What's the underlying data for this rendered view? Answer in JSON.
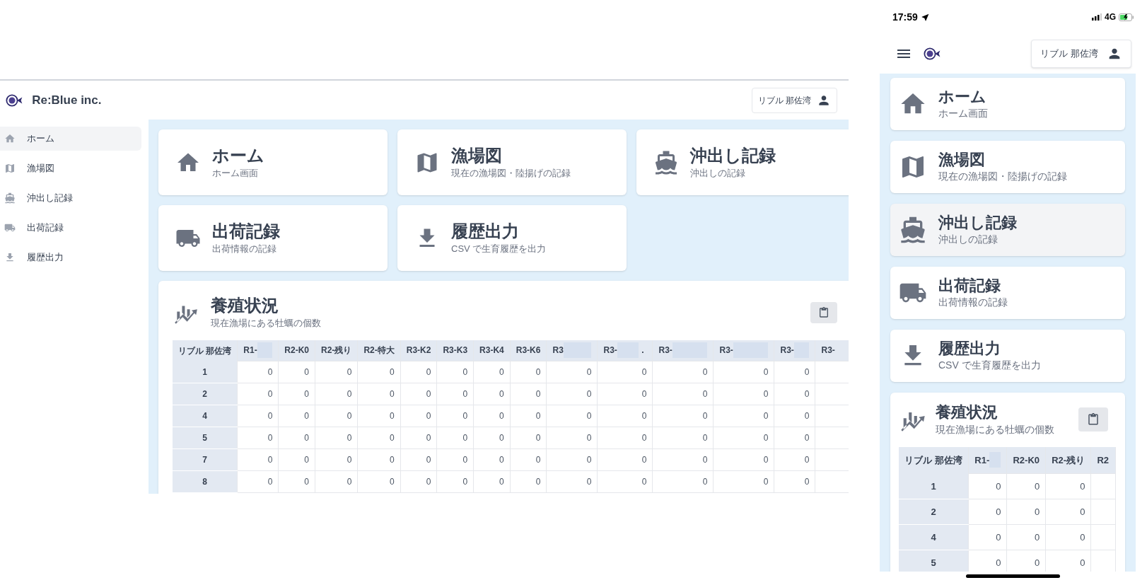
{
  "desktop": {
    "header": {
      "brand": "Re:Blue inc.",
      "user": "リブル 那佐湾"
    },
    "sidebar": {
      "items": [
        {
          "kind": "home",
          "label": "ホーム",
          "selected": true
        },
        {
          "kind": "map",
          "label": "漁場図",
          "selected": false
        },
        {
          "kind": "boat",
          "label": "沖出し記録",
          "selected": false
        },
        {
          "kind": "truck",
          "label": "出荷記録",
          "selected": false
        },
        {
          "kind": "download",
          "label": "履歴出力",
          "selected": false
        }
      ]
    },
    "cards": [
      {
        "kind": "home",
        "title": "ホーム",
        "subtitle": "ホーム画面"
      },
      {
        "kind": "map",
        "title": "漁場図",
        "subtitle": "現在の漁場図・陸揚げの記録"
      },
      {
        "kind": "boat",
        "title": "沖出し記録",
        "subtitle": "沖出しの記録"
      },
      {
        "kind": "truck",
        "title": "出荷記録",
        "subtitle": "出荷情報の記録"
      },
      {
        "kind": "download",
        "title": "履歴出力",
        "subtitle": "CSV で生育履歴を出力"
      }
    ],
    "status_panel": {
      "title": "養殖状況",
      "subtitle": "現在漁場にある牡蠣の個数",
      "table": {
        "columns": [
          {
            "label": "リブル 那佐湾"
          },
          {
            "label": "R1-",
            "redacted": true
          },
          {
            "label": "R2-K0"
          },
          {
            "label": "R2-残り"
          },
          {
            "label": "R2-特大"
          },
          {
            "label": "R3-K2"
          },
          {
            "label": "R3-K3"
          },
          {
            "label": "R3-K4"
          },
          {
            "label": "R3-K6"
          },
          {
            "label": "R3",
            "redacted": true
          },
          {
            "label": "R3-",
            "redacted": true,
            "suffix": "."
          },
          {
            "label": "R3-",
            "redacted": true
          },
          {
            "label": "R3-",
            "redacted": true
          },
          {
            "label": "R3-",
            "redacted": true
          },
          {
            "label": "R3-"
          }
        ],
        "rows": [
          {
            "label": "1",
            "values": [
              "0",
              "0",
              "0",
              "0",
              "0",
              "0",
              "0",
              "0",
              "0",
              "0",
              "0",
              "0",
              "0"
            ]
          },
          {
            "label": "2",
            "values": [
              "0",
              "0",
              "0",
              "0",
              "0",
              "0",
              "0",
              "0",
              "0",
              "0",
              "0",
              "0",
              "0"
            ]
          },
          {
            "label": "4",
            "values": [
              "0",
              "0",
              "0",
              "0",
              "0",
              "0",
              "0",
              "0",
              "0",
              "0",
              "0",
              "0",
              "0"
            ]
          },
          {
            "label": "5",
            "values": [
              "0",
              "0",
              "0",
              "0",
              "0",
              "0",
              "0",
              "0",
              "0",
              "0",
              "0",
              "0",
              "0"
            ]
          },
          {
            "label": "7",
            "values": [
              "0",
              "0",
              "0",
              "0",
              "0",
              "0",
              "0",
              "0",
              "0",
              "0",
              "0",
              "0",
              "0"
            ]
          },
          {
            "label": "8",
            "values": [
              "0",
              "0",
              "0",
              "0",
              "0",
              "0",
              "0",
              "0",
              "0",
              "0",
              "0",
              "0",
              "0"
            ]
          }
        ]
      }
    }
  },
  "mobile": {
    "status_bar": {
      "time": "17:59",
      "network": "4G"
    },
    "header": {
      "user": "リブル 那佐湾"
    },
    "cards": [
      {
        "kind": "home",
        "title": "ホーム",
        "subtitle": "ホーム画面",
        "selected": false
      },
      {
        "kind": "map",
        "title": "漁場図",
        "subtitle": "現在の漁場図・陸揚げの記録",
        "selected": false
      },
      {
        "kind": "boat",
        "title": "沖出し記録",
        "subtitle": "沖出しの記録",
        "selected": true
      },
      {
        "kind": "truck",
        "title": "出荷記録",
        "subtitle": "出荷情報の記録",
        "selected": false
      },
      {
        "kind": "download",
        "title": "履歴出力",
        "subtitle": "CSV で生育履歴を出力",
        "selected": false
      }
    ],
    "status_panel": {
      "title": "養殖状況",
      "subtitle": "現在漁場にある牡蠣の個数",
      "table": {
        "columns": [
          {
            "label": "リブル 那佐湾"
          },
          {
            "label": "R1-",
            "redacted": true
          },
          {
            "label": "R2-K0"
          },
          {
            "label": "R2-残り"
          },
          {
            "label": "R2"
          }
        ],
        "rows": [
          {
            "label": "1",
            "values": [
              "0",
              "0",
              "0"
            ]
          },
          {
            "label": "2",
            "values": [
              "0",
              "0",
              "0"
            ]
          },
          {
            "label": "4",
            "values": [
              "0",
              "0",
              "0"
            ]
          },
          {
            "label": "5",
            "values": [
              "0",
              "0",
              "0"
            ]
          }
        ]
      }
    }
  }
}
